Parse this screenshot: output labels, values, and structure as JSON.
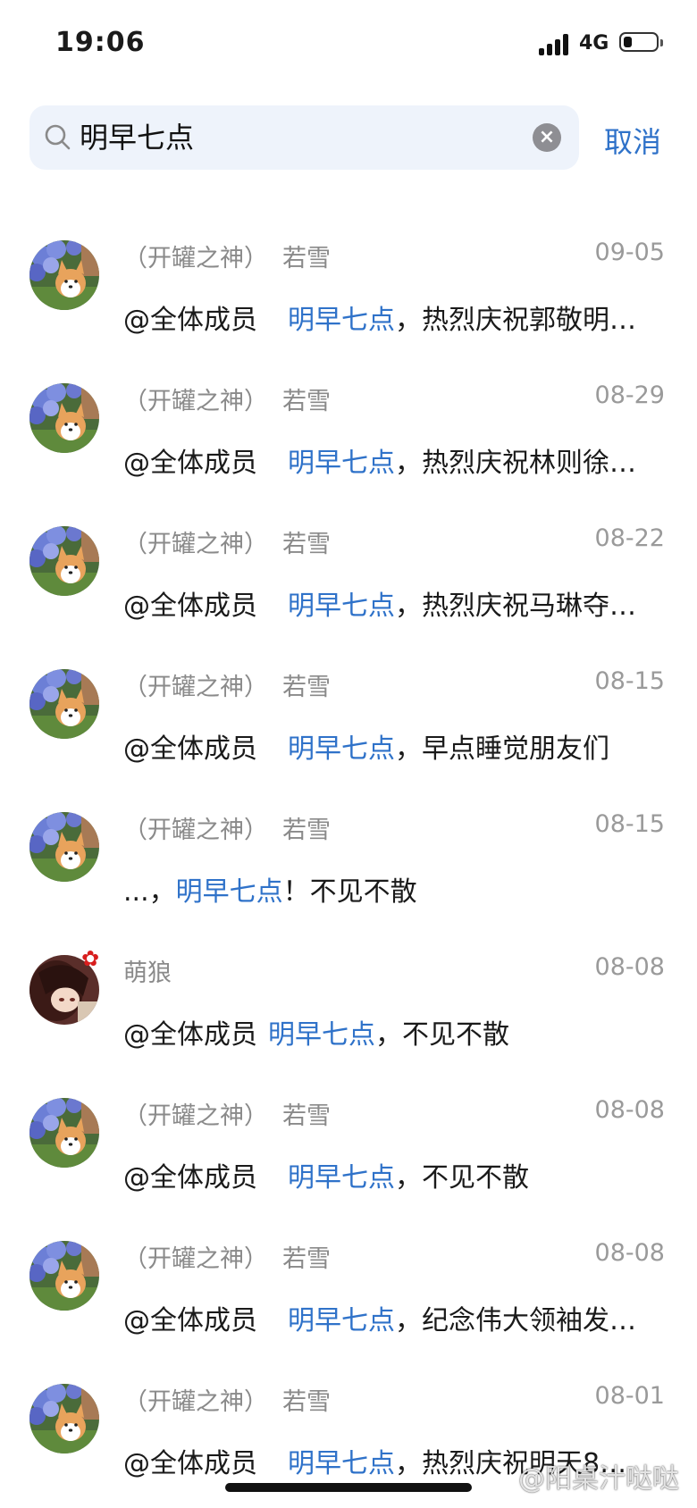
{
  "status_bar": {
    "time": "19:06",
    "network": "4G",
    "battery_level": 0.25
  },
  "search": {
    "query": "明早七点",
    "cancel_label": "取消"
  },
  "results": [
    {
      "group": "（开罐之神）",
      "name": "若雪",
      "date": "09-05",
      "mention": "@全体成员",
      "keyword": "明早七点",
      "rest": "，热烈庆祝郭敬明…",
      "avatar": "corgi-hydrangea"
    },
    {
      "group": "（开罐之神）",
      "name": "若雪",
      "date": "08-29",
      "mention": "@全体成员",
      "keyword": "明早七点",
      "rest": "，热烈庆祝林则徐…",
      "avatar": "corgi-hydrangea"
    },
    {
      "group": "（开罐之神）",
      "name": "若雪",
      "date": "08-22",
      "mention": "@全体成员",
      "keyword": "明早七点",
      "rest": "，热烈庆祝马琳夺…",
      "avatar": "corgi-hydrangea"
    },
    {
      "group": "（开罐之神）",
      "name": "若雪",
      "date": "08-15",
      "mention": "@全体成员",
      "keyword": "明早七点",
      "rest": "，早点睡觉朋友们",
      "avatar": "corgi-hydrangea"
    },
    {
      "group": "（开罐之神）",
      "name": "若雪",
      "date": "08-15",
      "mention": "...，",
      "keyword": "明早七点",
      "rest": "！不见不散",
      "avatar": "corgi-hydrangea"
    },
    {
      "group": "",
      "name": "萌狼",
      "date": "08-08",
      "mention": "@全体成员",
      "keyword": "明早七点",
      "rest": "，不见不散",
      "avatar": "anime-girl"
    },
    {
      "group": "（开罐之神）",
      "name": "若雪",
      "date": "08-08",
      "mention": "@全体成员",
      "keyword": "明早七点",
      "rest": "，不见不散",
      "avatar": "corgi-hydrangea"
    },
    {
      "group": "（开罐之神）",
      "name": "若雪",
      "date": "08-08",
      "mention": "@全体成员",
      "keyword": "明早七点",
      "rest": "，纪念伟大领袖发…",
      "avatar": "corgi-hydrangea"
    },
    {
      "group": "（开罐之神）",
      "name": "若雪",
      "date": "08-01",
      "mention": "@全体成员",
      "keyword": "明早七点",
      "rest": "，热烈庆祝明天8…",
      "avatar": "corgi-hydrangea"
    }
  ],
  "watermark": "@阳桌汁哒哒",
  "colors": {
    "highlight": "#2f72c9",
    "search_bg": "#eef3fb",
    "meta_gray": "#8a8a8a"
  }
}
